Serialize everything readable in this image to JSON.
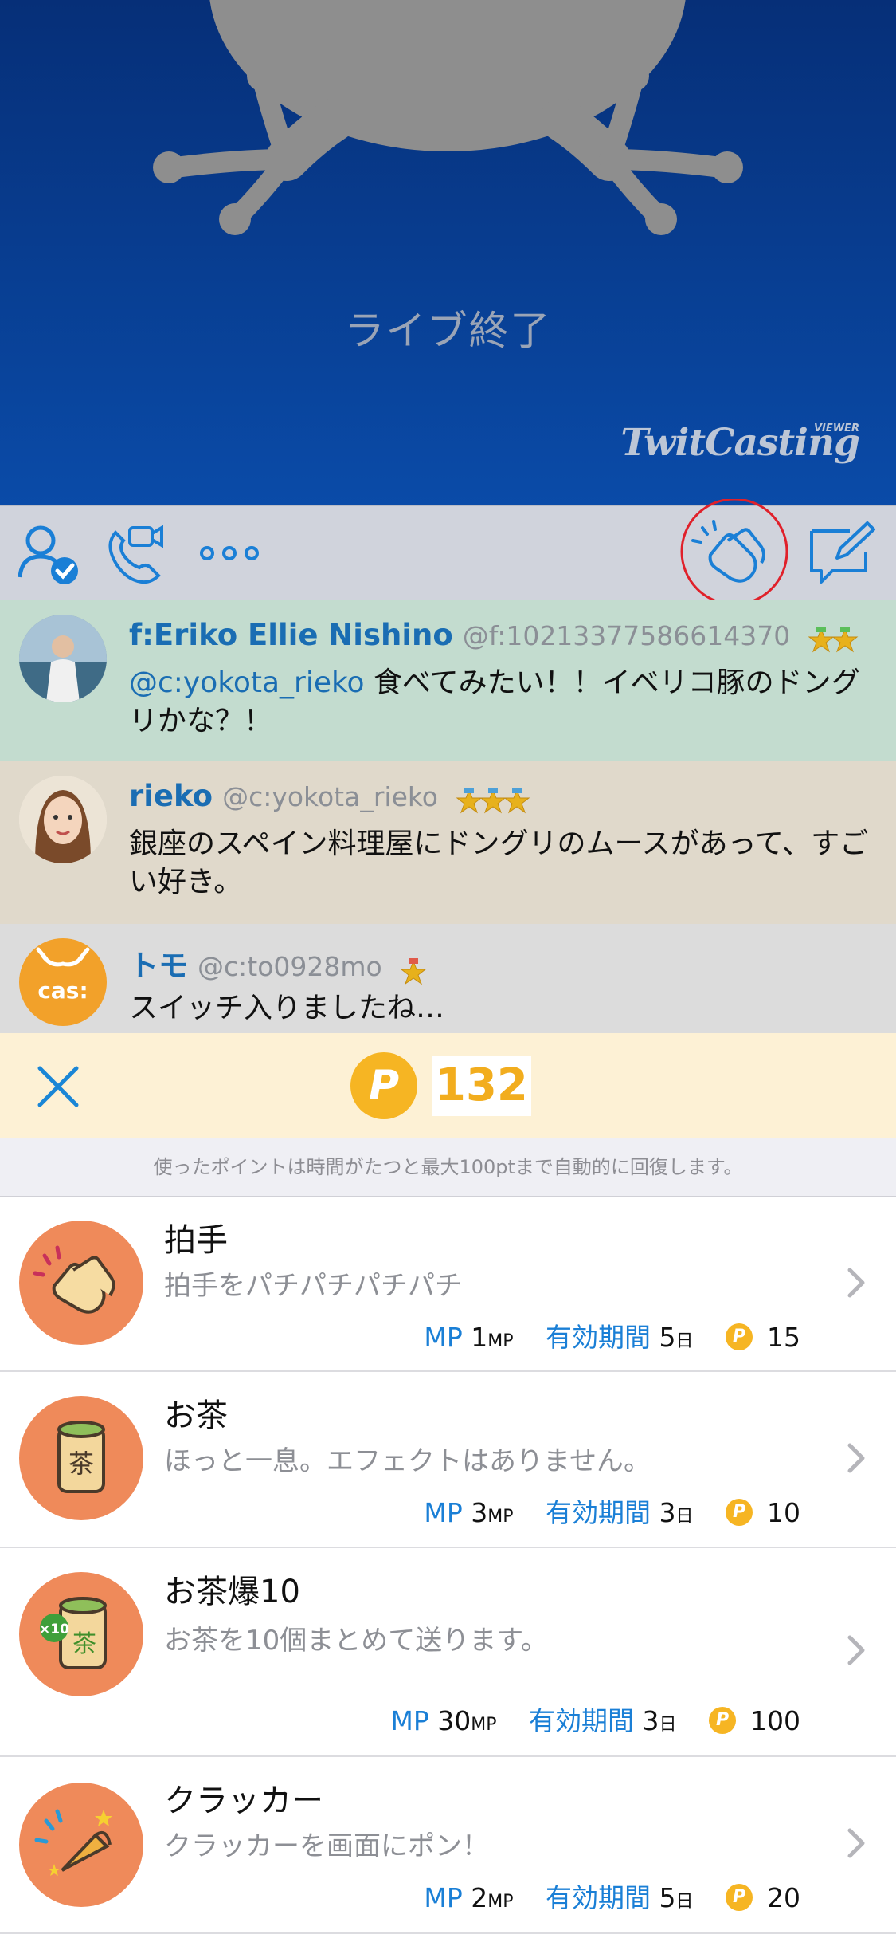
{
  "video": {
    "status_text": "ライブ終了",
    "brand": "TwitCasting",
    "brand_tag": "VIEWER"
  },
  "toolbar": {
    "icons": [
      "user-check-icon",
      "video-phone-icon",
      "more-icon",
      "clap-icon",
      "compose-icon"
    ],
    "highlight_color": "#e0202a"
  },
  "comments": [
    {
      "name": "f:Eriko Ellie Nishino",
      "id": "@f:10213377586614370",
      "mention": "@c:yokota_rieko",
      "text": " 食べてみたい！！イベリコ豚のドングリかな？！",
      "medals": 2,
      "bg": "#c3dccf"
    },
    {
      "name": "rieko",
      "id": "@c:yokota_rieko",
      "text": "銀座のスペイン料理屋にドングリのムースがあって、すごい好き。",
      "medals": 3,
      "bg": "#e0d9cb"
    },
    {
      "name": "トモ",
      "id": "@c:to0928mo",
      "text": "スイッチ入りましたね…",
      "avatar_text": "cas:",
      "medals": 1,
      "bg": "#dcdcdc"
    }
  ],
  "points": {
    "coin_letter": "P",
    "value": "132",
    "notice": "使ったポイントは時間がたつと最大100ptまで自動的に回復します。"
  },
  "items": [
    {
      "title": "拍手",
      "desc": "拍手をパチパチパチパチ",
      "mp_label": "MP",
      "mp_value": "1",
      "mp_unit": "MP",
      "period_label": "有効期間",
      "period_value": "5",
      "period_unit": "日",
      "cost": "15",
      "icon": "clap-hands-icon"
    },
    {
      "title": "お茶",
      "desc": "ほっと一息。エフェクトはありません。",
      "mp_label": "MP",
      "mp_value": "3",
      "mp_unit": "MP",
      "period_label": "有効期間",
      "period_value": "3",
      "period_unit": "日",
      "cost": "10",
      "icon": "tea-cup-icon",
      "icon_text": "茶"
    },
    {
      "title": "お茶爆10",
      "desc": "お茶を10個まとめて送ります。",
      "mp_label": "MP",
      "mp_value": "30",
      "mp_unit": "MP",
      "period_label": "有効期間",
      "period_value": "3",
      "period_unit": "日",
      "cost": "100",
      "icon": "tea-bomb-icon",
      "icon_text": "茶",
      "badge": "×10"
    },
    {
      "title": "クラッカー",
      "desc": "クラッカーを画面にポン！",
      "mp_label": "MP",
      "mp_value": "2",
      "mp_unit": "MP",
      "period_label": "有効期間",
      "period_value": "5",
      "period_unit": "日",
      "cost": "20",
      "icon": "party-popper-icon"
    }
  ]
}
